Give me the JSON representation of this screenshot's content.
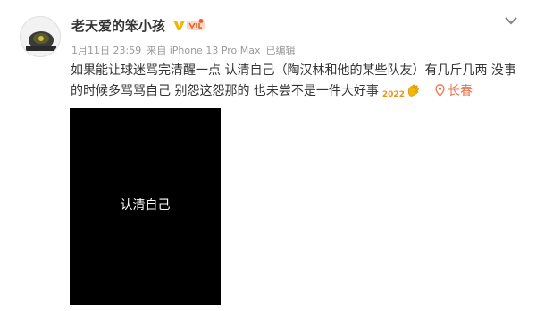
{
  "post": {
    "author": "老天爱的笨小孩",
    "meta": {
      "date": "1月11日 23:59",
      "source": "来自 iPhone 13 Pro Max",
      "edited": "已编辑"
    },
    "text_line1": "如果能让球迷骂完清醒一点 认清自己（陶汉林和他的某些队友）有几斤几两 没事",
    "text_line2": "的时候多骂骂自己 别怨这怨那的 也未尝不是一件大好事",
    "badge_2022": "2022",
    "location": "长春",
    "media_caption": "认清自己"
  },
  "colors": {
    "text": "#333333",
    "meta": "#999999",
    "accent": "#eb7350",
    "verified_badge": "#f2b705",
    "media_bg": "#000000"
  },
  "icons": [
    "avatar",
    "verified-v-icon",
    "vip-badge-icon",
    "more-chevron-icon",
    "clap-emoji-icon",
    "location-pin-icon"
  ]
}
